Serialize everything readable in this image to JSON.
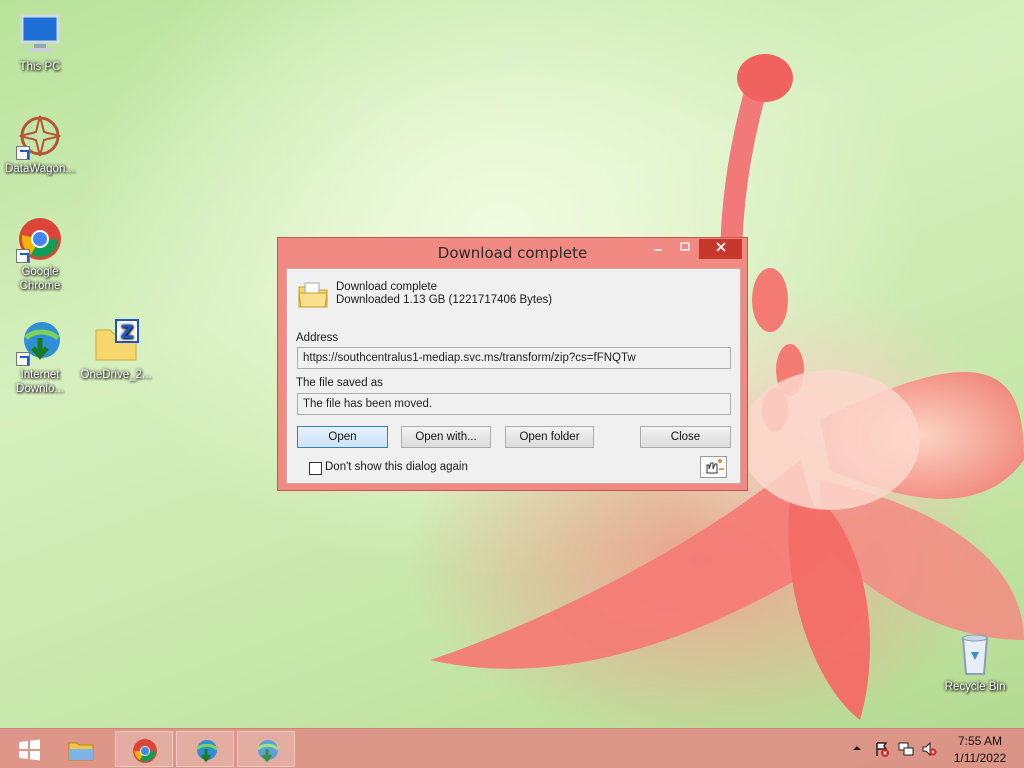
{
  "desktop": {
    "icons": [
      {
        "label": "This PC",
        "icon": "this-pc-icon"
      },
      {
        "label": "DataWagon...",
        "icon": "datawagon-icon"
      },
      {
        "label": "Google Chrome",
        "icon": "chrome-icon"
      },
      {
        "label": "Internet Downlo...",
        "icon": "idm-icon"
      },
      {
        "label": "OneDrive_2...",
        "icon": "zip-folder-icon"
      },
      {
        "label": "Recycle Bin",
        "icon": "recycle-bin-icon"
      }
    ]
  },
  "dialog": {
    "title": "Download complete",
    "status_heading": "Download complete",
    "status_detail": "Downloaded  1.13  GB (1221717406 Bytes)",
    "address_label": "Address",
    "address_value": "https://southcentralus1-mediap.svc.ms/transform/zip?cs=fFNQTw",
    "saved_label": "The file saved as",
    "saved_value": "The file has been moved.",
    "buttons": {
      "open": "Open",
      "open_with": "Open with...",
      "open_folder": "Open folder",
      "close": "Close"
    },
    "checkbox_label": "Don't show this dialog again",
    "checkbox_checked": false
  },
  "taskbar": {
    "time": "7:55 AM",
    "date": "1/11/2022",
    "items": [
      "start-icon",
      "file-explorer-icon",
      "chrome-icon",
      "idm-icon",
      "idm-icon"
    ]
  },
  "colors": {
    "dialog_frame": "#f08a82",
    "close_button": "#c7372b",
    "taskbar": "#de8f85"
  }
}
